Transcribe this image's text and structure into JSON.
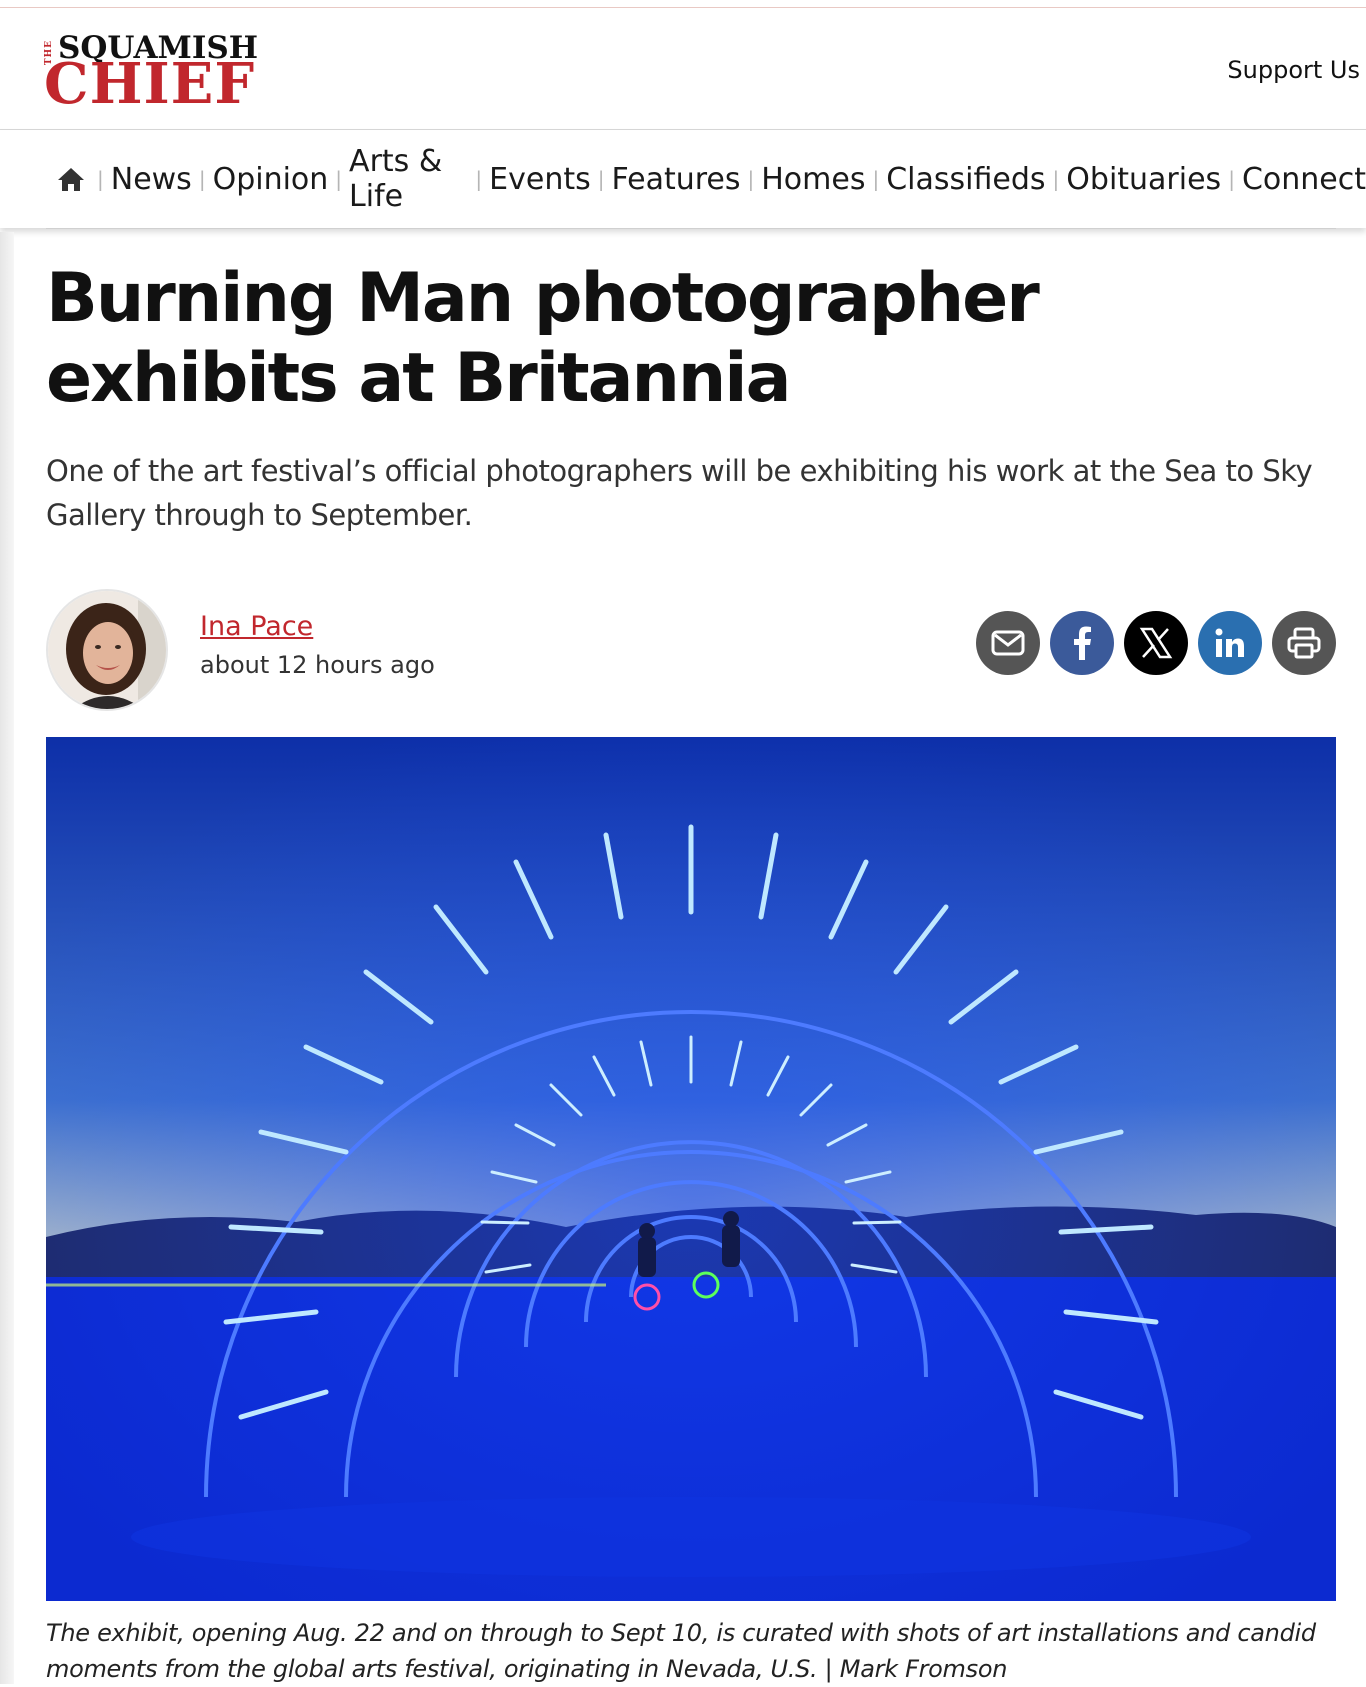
{
  "header": {
    "logo_the": "THE",
    "logo_top": "SQUAMISH",
    "logo_bottom": "CHIEF",
    "support_label": "Support Us"
  },
  "nav": {
    "home_icon": "home-icon",
    "items": [
      "News",
      "Opinion",
      "Arts & Life",
      "Events",
      "Features",
      "Homes",
      "Classifieds",
      "Obituaries",
      "Connect"
    ]
  },
  "article": {
    "title": "Burning Man photographer exhibits at Britannia",
    "subhead": "One of the art festival’s official photographers will be exhibiting his work at the Sea to Sky Gallery through to September.",
    "author": "Ina Pace",
    "timestamp": "about 12 hours ago",
    "caption": "The exhibit, opening Aug. 22 and on through to Sept 10, is curated with shots of art installations and candid moments from the global arts festival, originating in Nevada, U.S.  |  Mark Fromson"
  },
  "share": {
    "icons": [
      "email-icon",
      "facebook-icon",
      "x-icon",
      "linkedin-icon",
      "print-icon"
    ]
  },
  "colors": {
    "brand_red": "#c1272d",
    "facebook": "#3b5a9a",
    "linkedin": "#2a6fb0",
    "share_gray": "#555555"
  }
}
